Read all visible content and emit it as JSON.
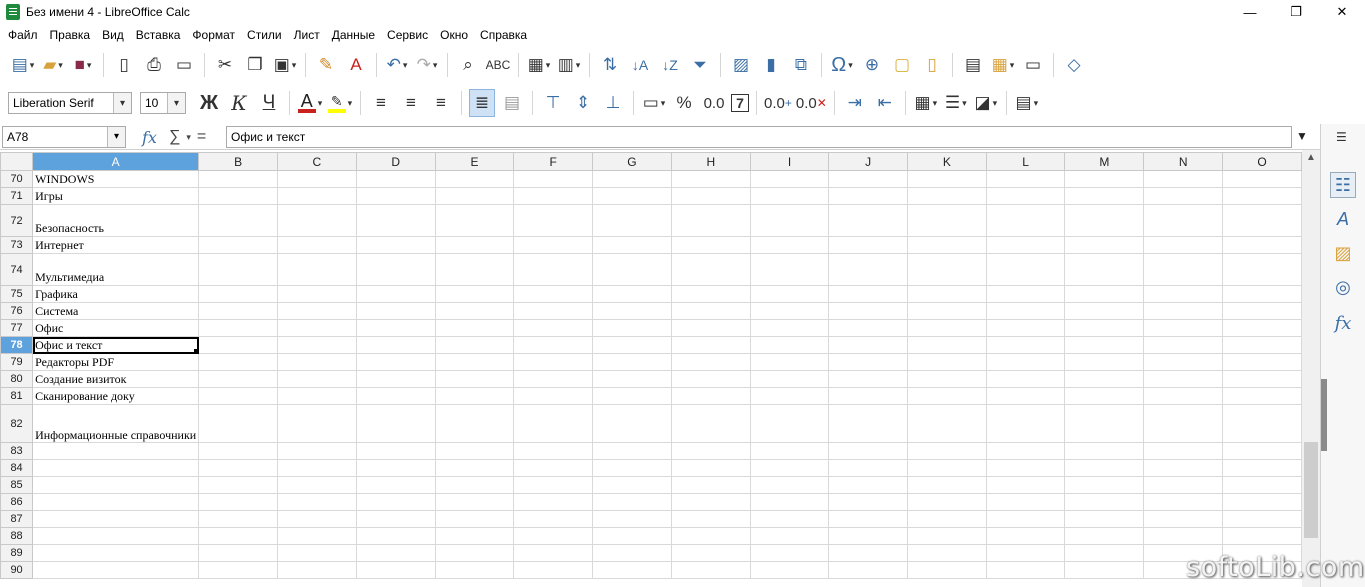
{
  "window": {
    "title": "Без имени 4 - LibreOffice Calc",
    "controls": {
      "minimize": "—",
      "restore": "❐",
      "close": "✕"
    }
  },
  "menu": [
    "Файл",
    "Правка",
    "Вид",
    "Вставка",
    "Формат",
    "Стили",
    "Лист",
    "Данные",
    "Сервис",
    "Окно",
    "Справка"
  ],
  "toolbar2": {
    "font_name": "Liberation Serif",
    "font_size": "10",
    "bold": "Ж",
    "italic": "К",
    "underline": "Ч",
    "font_color_letter": "A",
    "percent": "%",
    "decimal_std": "0.0",
    "add_decimal": "0.0",
    "del_decimal": "0.0"
  },
  "formula_bar": {
    "name_box": "A78",
    "fx": "fx",
    "sum": "∑",
    "equals": "=",
    "content": "Офис и текст"
  },
  "grid": {
    "columns": [
      "A",
      "B",
      "C",
      "D",
      "E",
      "F",
      "G",
      "H",
      "I",
      "J",
      "K",
      "L",
      "M",
      "N",
      "O"
    ],
    "selected_column": "A",
    "selected_row": "78",
    "rows": [
      {
        "num": "70",
        "a": "WINDOWS"
      },
      {
        "num": "71",
        "a": "Игры"
      },
      {
        "num": "72",
        "a": "Безопасность"
      },
      {
        "num": "73",
        "a": "Интернет"
      },
      {
        "num": "74",
        "a": "Мультимедиа"
      },
      {
        "num": "75",
        "a": "Графика"
      },
      {
        "num": "76",
        "a": "Система"
      },
      {
        "num": "77",
        "a": "Офис"
      },
      {
        "num": "78",
        "a": "Офис и текст"
      },
      {
        "num": "79",
        "a": "Редакторы PDF"
      },
      {
        "num": "80",
        "a": "Создание визиток"
      },
      {
        "num": "81",
        "a": "Сканирование доку"
      },
      {
        "num": "82",
        "a": "Информационные справочники"
      },
      {
        "num": "83",
        "a": ""
      },
      {
        "num": "84",
        "a": ""
      },
      {
        "num": "85",
        "a": ""
      },
      {
        "num": "86",
        "a": ""
      },
      {
        "num": "87",
        "a": ""
      },
      {
        "num": "88",
        "a": ""
      },
      {
        "num": "89",
        "a": ""
      },
      {
        "num": "90",
        "a": ""
      }
    ]
  },
  "sidebar": {
    "icons": [
      "properties-icon",
      "styles-icon",
      "gallery-icon",
      "navigator-icon",
      "functions-icon"
    ],
    "functions_label": "fx"
  },
  "watermark": "softoLib.com",
  "colors": {
    "header_selected": "#5ea2dd",
    "link_text": "#2b2b7a",
    "font_color": "#c9211e",
    "highlight": "#ffff00"
  }
}
